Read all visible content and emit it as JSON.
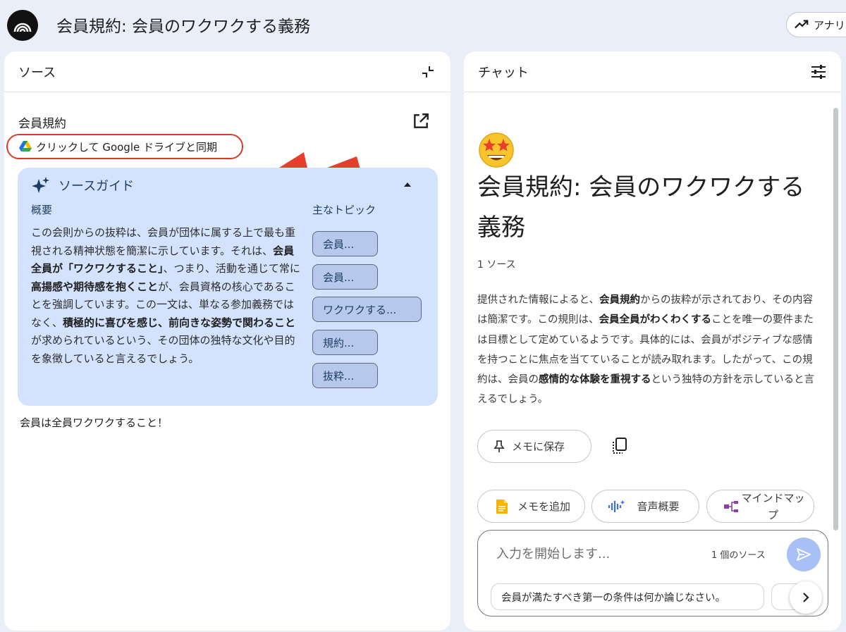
{
  "app": {
    "title": "会員規約: 会員のワクワクする義務",
    "analytics_label": "アナリ"
  },
  "source_panel": {
    "header": "ソース",
    "source_name": "会員規約",
    "sync_label": "クリックして Google ドライブと同期",
    "guide": {
      "title": "ソースガイド",
      "overview_label": "概要",
      "topics_label": "主なトピック",
      "summary": [
        {
          "t": "この会則からの抜粋は、会員が団体に属する上で最も重視される精神状態を簡潔に示しています。それは、",
          "b": false
        },
        {
          "t": "会員全員が「ワクワクすること」",
          "b": true
        },
        {
          "t": "、つまり、活動を通じて常に",
          "b": false
        },
        {
          "t": "高揚感や期待感を抱くこと",
          "b": true
        },
        {
          "t": "が、会員資格の核心であることを強調しています。この一文は、単なる参加義務ではなく、",
          "b": false
        },
        {
          "t": "積極的に喜びを感じ、前向きな姿勢で関わること",
          "b": true
        },
        {
          "t": "が求められているという、その団体の独特な文化や目的を象徴していると言えるでしょう。",
          "b": false
        }
      ],
      "topics": [
        "会員...",
        "会員...",
        "ワクワクする...",
        "規約...",
        "抜粋..."
      ]
    },
    "body_text": "会員は全員ワクワクすること！"
  },
  "chat_panel": {
    "header": "チャット",
    "title": "会員規約: 会員のワクワクする義務",
    "source_count": "1 ソース",
    "answer": [
      {
        "t": "提供された情報によると、",
        "b": false
      },
      {
        "t": "会員規約",
        "b": true
      },
      {
        "t": "からの抜粋が示されており、その内容は簡潔です。この規則は、",
        "b": false
      },
      {
        "t": "会員全員がわくわくする",
        "b": true
      },
      {
        "t": "ことを唯一の要件または目標として定めているようです。具体的には、会員がポジティブな感情を持つことに焦点を当てていることが読み取れます。したがって、この規約は、会員の",
        "b": false
      },
      {
        "t": "感情的な体験を重視する",
        "b": true
      },
      {
        "t": "という独特の方針を示していると言えるでしょう。",
        "b": false
      }
    ],
    "save_note_label": "メモに保存",
    "chips": {
      "add_note": "メモを追加",
      "audio_overview": "音声概要",
      "mind_map": "マインドマップ"
    },
    "input_placeholder": "入力を開始します...",
    "input_source_count": "1 個のソース",
    "suggestion": "会員が満たすべき第一の条件は何か論じなさい。"
  },
  "colors": {
    "background": "#eaeef9",
    "guide_bg": "#d3e3fd",
    "highlight_red": "#d93a2b",
    "send_button": "#a8c0f5"
  }
}
